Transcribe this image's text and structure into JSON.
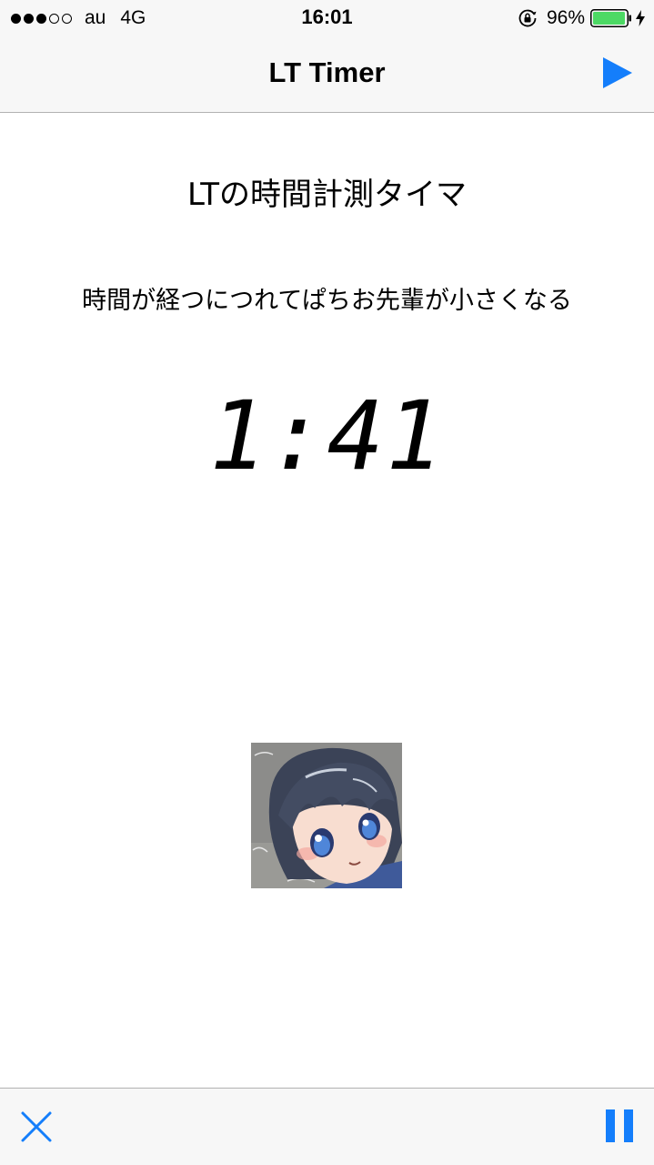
{
  "status_bar": {
    "carrier": "au",
    "network": "4G",
    "time": "16:01",
    "battery_percent": "96%",
    "signal_bars_filled": 3,
    "signal_bars_total": 5,
    "icons": [
      "signal-dots",
      "rotation-lock-icon",
      "battery-icon",
      "charging-bolt-icon"
    ]
  },
  "nav_bar": {
    "title": "LT Timer",
    "right_button_icon": "play-icon"
  },
  "content": {
    "heading": "LTの時間計測タイマ",
    "subheading": "時間が経つにつれてぱちお先輩が小さくなる",
    "timer": "1:41",
    "avatar_icon": "anime-character-avatar"
  },
  "toolbar": {
    "left_button_icon": "close-icon",
    "right_button_icon": "pause-icon"
  },
  "colors": {
    "accent": "#147efb",
    "bar_background": "#f7f7f7",
    "separator": "#b2b2b2",
    "battery_fill": "#4cd964"
  }
}
